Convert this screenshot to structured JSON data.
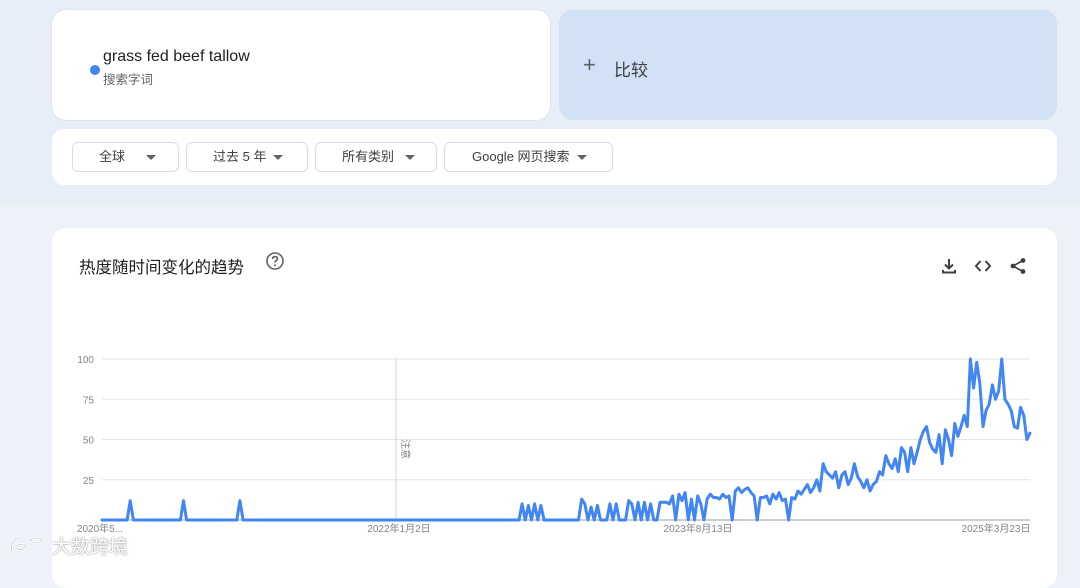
{
  "search_term": {
    "name": "grass fed beef tallow",
    "type": "搜索字词",
    "color": "#4285f4"
  },
  "compare": {
    "plus": "+",
    "label": "比较"
  },
  "filters": [
    {
      "label": "全球"
    },
    {
      "label": "过去 5 年"
    },
    {
      "label": "所有类别"
    },
    {
      "label": "Google 网页搜索"
    }
  ],
  "chart_section": {
    "title": "热度随时间变化的趋势",
    "icons": [
      "help-icon",
      "download-icon",
      "embed-code-icon",
      "share-icon"
    ]
  },
  "chart_data": {
    "type": "line",
    "x_tick_labels": [
      "2020年5...",
      "2022年1月2日",
      "2023年8月13日",
      "2025年3月23日"
    ],
    "y_ticks": [
      100,
      75,
      50,
      25
    ],
    "ylim": [
      0,
      100
    ],
    "grid": true,
    "annotation": "注意",
    "series": [
      {
        "color": "#4285f4",
        "values": [
          0,
          0,
          0,
          0,
          0,
          0,
          0,
          0,
          0,
          12,
          0,
          0,
          0,
          0,
          0,
          0,
          0,
          0,
          0,
          0,
          0,
          0,
          0,
          0,
          0,
          0,
          12,
          0,
          0,
          0,
          0,
          0,
          0,
          0,
          0,
          0,
          0,
          0,
          0,
          0,
          0,
          0,
          0,
          0,
          12,
          0,
          0,
          0,
          0,
          0,
          0,
          0,
          0,
          0,
          0,
          0,
          0,
          0,
          0,
          0,
          0,
          0,
          0,
          0,
          0,
          0,
          0,
          0,
          0,
          0,
          0,
          0,
          0,
          0,
          0,
          0,
          0,
          0,
          0,
          0,
          0,
          0,
          0,
          0,
          0,
          0,
          0,
          0,
          0,
          0,
          0,
          0,
          0,
          0,
          0,
          0,
          0,
          0,
          0,
          0,
          0,
          0,
          0,
          0,
          0,
          0,
          0,
          0,
          0,
          0,
          0,
          0,
          0,
          0,
          0,
          0,
          0,
          0,
          0,
          0,
          0,
          0,
          0,
          0,
          0,
          0,
          0,
          0,
          0,
          0,
          0,
          0,
          0,
          0,
          10,
          0,
          9,
          0,
          10,
          0,
          9,
          0,
          0,
          0,
          0,
          0,
          0,
          0,
          0,
          0,
          0,
          0,
          0,
          13,
          10,
          0,
          8,
          0,
          9,
          0,
          0,
          0,
          10,
          0,
          10,
          0,
          0,
          0,
          12,
          10,
          0,
          11,
          0,
          11,
          0,
          10,
          0,
          0,
          11,
          11,
          11,
          10,
          15,
          0,
          16,
          12,
          17,
          0,
          13,
          0,
          15,
          10,
          0,
          13,
          16,
          14,
          14,
          13,
          16,
          14,
          15,
          0,
          18,
          20,
          17,
          19,
          20,
          17,
          15,
          0,
          14,
          14,
          15,
          10,
          16,
          13,
          17,
          12,
          13,
          0,
          14,
          13,
          18,
          16,
          19,
          22,
          17,
          20,
          25,
          18,
          35,
          30,
          28,
          26,
          30,
          20,
          28,
          30,
          22,
          26,
          35,
          27,
          24,
          20,
          25,
          18,
          22,
          24,
          30,
          28,
          40,
          35,
          32,
          38,
          30,
          45,
          42,
          30,
          45,
          35,
          42,
          50,
          55,
          58,
          48,
          44,
          42,
          53,
          35,
          56,
          50,
          40,
          60,
          52,
          58,
          65,
          58,
          100,
          82,
          98,
          85,
          58,
          68,
          72,
          84,
          75,
          80,
          100,
          75,
          72,
          68,
          58,
          57,
          70,
          65,
          50,
          54
        ]
      }
    ]
  },
  "watermark": "大数跨境"
}
